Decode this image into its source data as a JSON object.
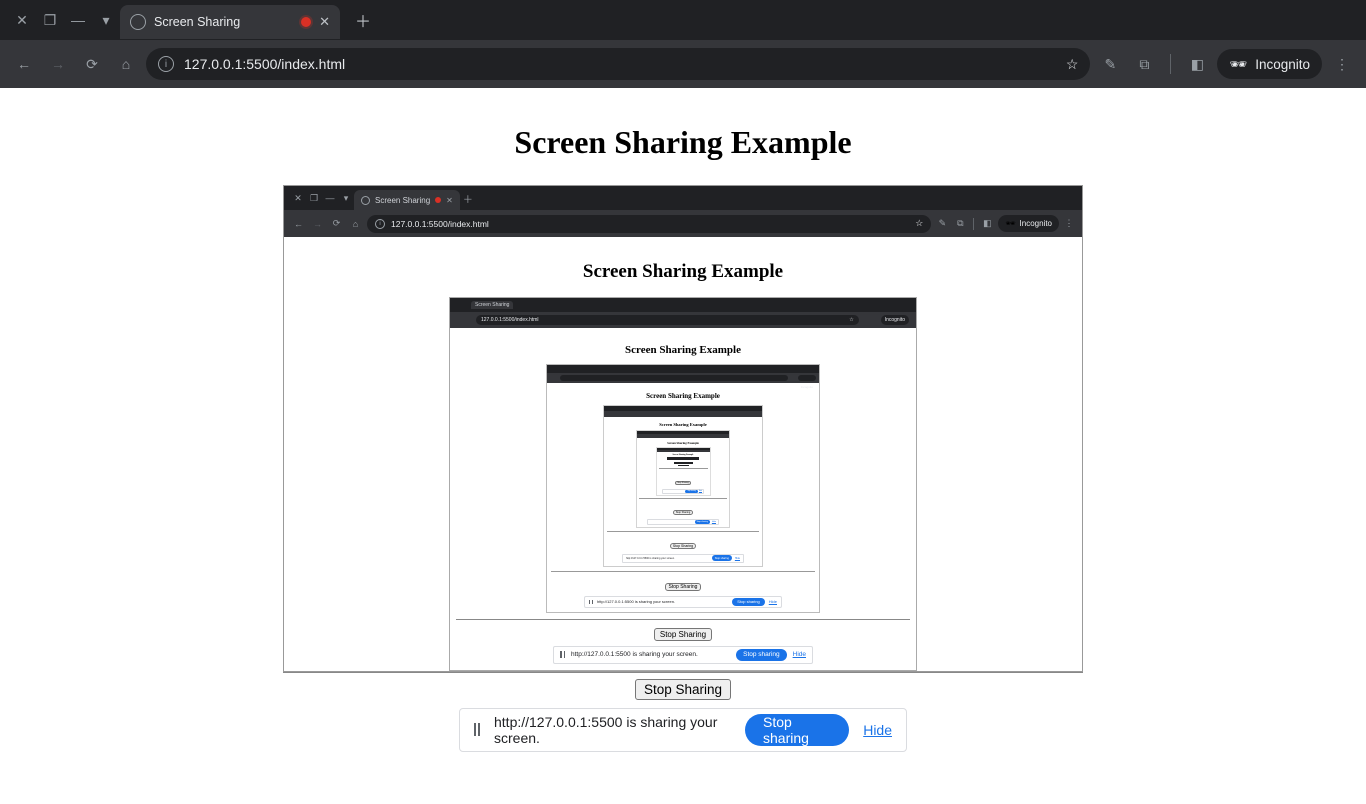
{
  "browser": {
    "tab_title": "Screen Sharing",
    "url": "127.0.0.1:5500/index.html",
    "incognito_label": "Incognito"
  },
  "page": {
    "heading": "Screen Sharing Example",
    "stop_button_label": "Stop Sharing"
  },
  "share_notice": {
    "text": "http://127.0.0.1:5500 is sharing your screen.",
    "stop_label": "Stop sharing",
    "hide_label": "Hide"
  },
  "nested": {
    "heading": "Screen Sharing Example",
    "tab_title": "Screen Sharing",
    "url": "127.0.0.1:5500/index.html",
    "incognito_label": "Incognito",
    "stop_button_label": "Stop Sharing",
    "share_text": "http://127.0.0.1:5500 is sharing your screen.",
    "share_stop": "Stop sharing",
    "share_hide": "Hide"
  }
}
